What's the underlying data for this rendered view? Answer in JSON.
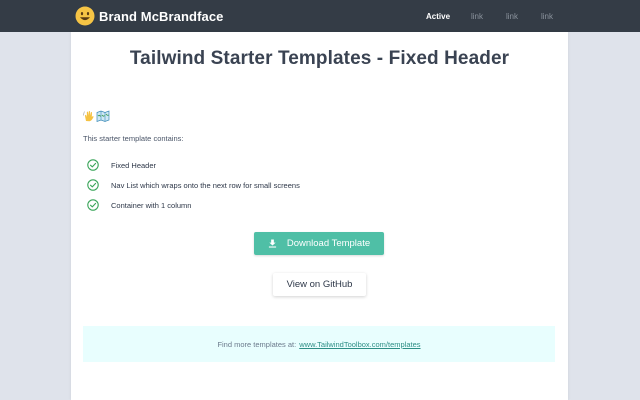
{
  "nav": {
    "brand": "Brand McBrandface",
    "brand_icon": "smiley-face-icon",
    "links": [
      {
        "label": "Active",
        "active": true
      },
      {
        "label": "link",
        "active": false
      },
      {
        "label": "link",
        "active": false
      },
      {
        "label": "link",
        "active": false
      }
    ]
  },
  "main": {
    "title": "Tailwind Starter Templates - Fixed Header",
    "emoji_icons": [
      "waving-hand-icon",
      "map-icon"
    ],
    "intro": "This starter template contains:",
    "features": [
      "Fixed Header",
      "Nav List which wraps onto the next row for small screens",
      "Container with 1 column"
    ],
    "download_button": "Download Template",
    "github_button": "View on GitHub"
  },
  "footer": {
    "text": "Find more templates at:",
    "link": "www.TailwindToolbox.com/templates"
  },
  "colors": {
    "nav_bg": "#343c46",
    "accent": "#4fbfa6",
    "check": "#3aa55a",
    "footer_bg": "#e8fefe",
    "page_bg": "#dfe3eb"
  }
}
